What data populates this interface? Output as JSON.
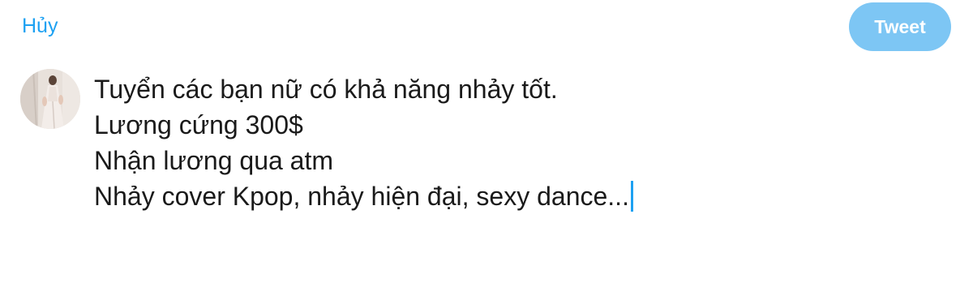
{
  "header": {
    "cancel_label": "Hủy",
    "tweet_label": "Tweet"
  },
  "composer": {
    "lines": [
      "Tuyển các bạn nữ có khả năng nhảy tốt.",
      "Lương cứng 300$",
      "Nhận lương qua atm",
      "Nhảy cover Kpop, nhảy hiện đại, sexy dance..."
    ]
  },
  "colors": {
    "accent": "#1da1f2",
    "tweet_button_disabled": "#7dc6f4",
    "text": "#1a1a1a",
    "background": "#ffffff"
  },
  "icons": {
    "avatar": "user-profile-photo"
  }
}
